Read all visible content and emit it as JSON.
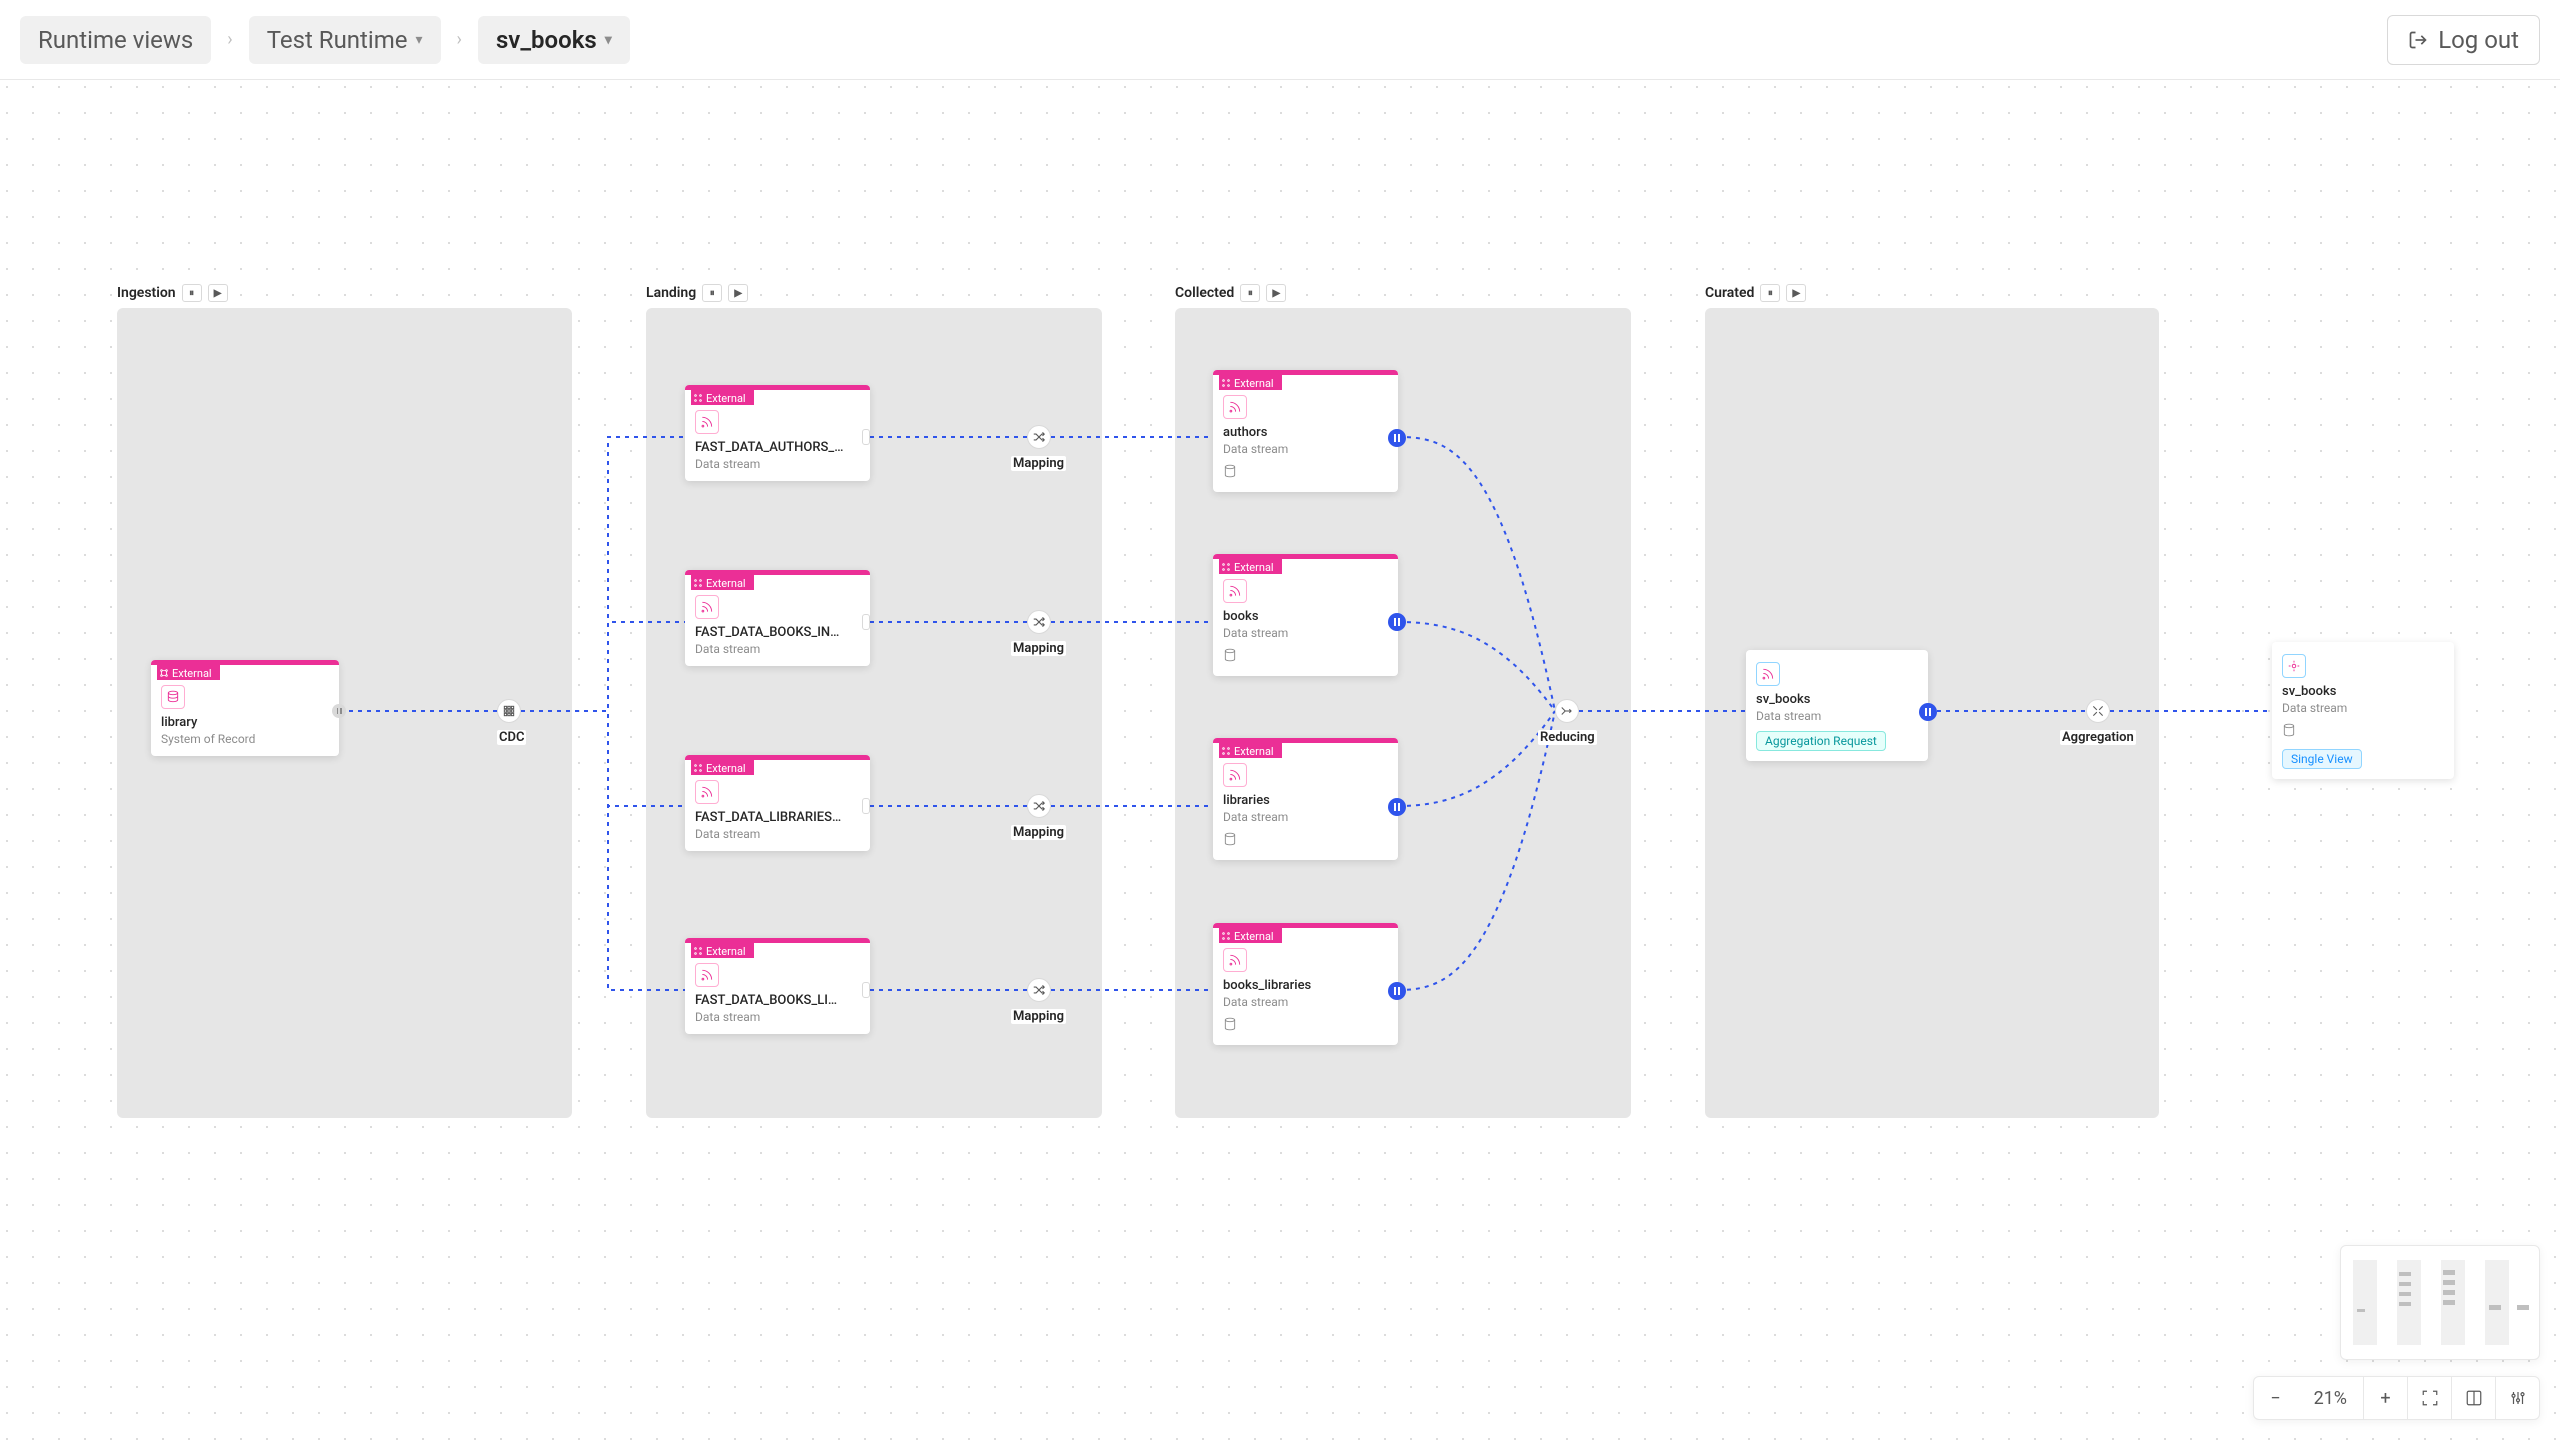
{
  "breadcrumb": {
    "root": "Runtime views",
    "second": "Test Runtime",
    "third": "sv_books"
  },
  "logout_label": "Log out",
  "stages": {
    "ingestion": {
      "label": "Ingestion"
    },
    "landing": {
      "label": "Landing"
    },
    "collected": {
      "label": "Collected"
    },
    "curated": {
      "label": "Curated"
    }
  },
  "flow_labels": {
    "cdc": "CDC",
    "mapping": "Mapping",
    "reducing": "Reducing",
    "aggregation": "Aggregation"
  },
  "external_label": "External",
  "sub_data_stream": "Data stream",
  "sub_sor": "System of Record",
  "pill_aggreq": "Aggregation Request",
  "pill_singleview": "Single View",
  "library_card": {
    "title": "library"
  },
  "landing_cards": {
    "a": {
      "title": "FAST_DATA_AUTHORS_…"
    },
    "b": {
      "title": "FAST_DATA_BOOKS_IN…"
    },
    "c": {
      "title": "FAST_DATA_LIBRARIES…"
    },
    "d": {
      "title": "FAST_DATA_BOOKS_LI…"
    }
  },
  "collected_cards": {
    "a": {
      "title": "authors"
    },
    "b": {
      "title": "books"
    },
    "c": {
      "title": "libraries"
    },
    "d": {
      "title": "books_libraries"
    }
  },
  "curated_card": {
    "title": "sv_books"
  },
  "output_card": {
    "title": "sv_books"
  },
  "zoom_value": "21%"
}
